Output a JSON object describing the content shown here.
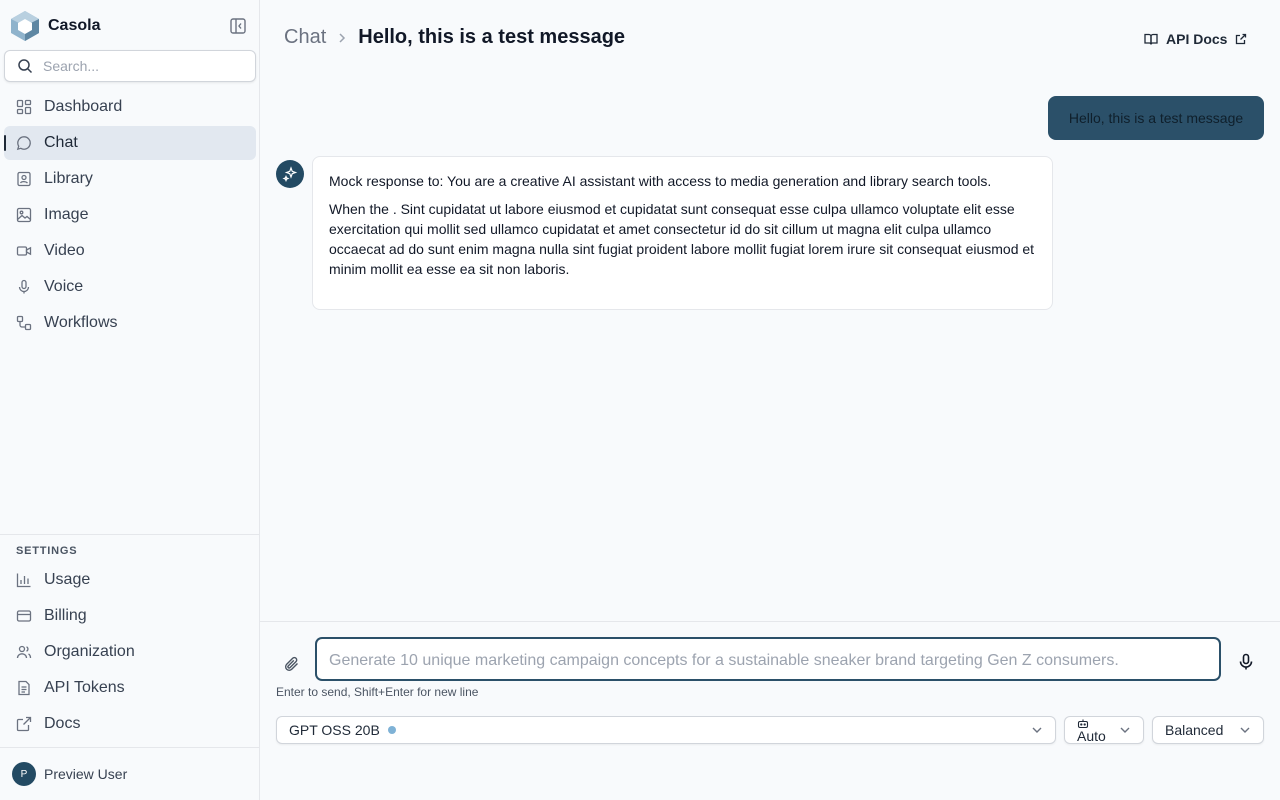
{
  "brand": {
    "name": "Casola"
  },
  "search": {
    "placeholder": "Search..."
  },
  "nav": [
    {
      "label": "Dashboard",
      "icon": "dashboard-icon"
    },
    {
      "label": "Chat",
      "icon": "chat-bubble-icon",
      "active": true
    },
    {
      "label": "Library",
      "icon": "library-icon"
    },
    {
      "label": "Image",
      "icon": "image-icon"
    },
    {
      "label": "Video",
      "icon": "video-icon"
    },
    {
      "label": "Voice",
      "icon": "microphone-icon"
    },
    {
      "label": "Workflows",
      "icon": "workflow-icon"
    }
  ],
  "settings": {
    "label": "SETTINGS",
    "items": [
      {
        "label": "Usage",
        "icon": "bar-chart-icon"
      },
      {
        "label": "Billing",
        "icon": "credit-card-icon"
      },
      {
        "label": "Organization",
        "icon": "users-icon"
      },
      {
        "label": "API Tokens",
        "icon": "document-icon"
      },
      {
        "label": "Docs",
        "icon": "external-link-icon"
      }
    ]
  },
  "user": {
    "initial": "P",
    "name": "Preview User"
  },
  "header": {
    "breadcrumb_root": "Chat",
    "title": "Hello, this is a test message",
    "api_docs": "API Docs"
  },
  "messages": {
    "user": "Hello, this is a test message",
    "assistant": [
      "Mock response to: You are a creative AI assistant with access to media generation and library search tools.",
      "When the . Sint cupidatat ut labore eiusmod et cupidatat sunt consequat esse culpa ullamco voluptate elit esse exercitation qui mollit sed ullamco cupidatat et amet consectetur id do sit cillum ut magna elit culpa ullamco occaecat ad do sunt enim magna nulla sint fugiat proident labore mollit fugiat lorem irure sit consequat eiusmod et minim mollit ea esse ea sit non laboris."
    ]
  },
  "composer": {
    "placeholder": "Generate 10 unique marketing campaign concepts for a sustainable sneaker brand targeting Gen Z consumers.",
    "hint": "Enter to send, Shift+Enter for new line",
    "model": "GPT OSS 20B",
    "mode": "Auto",
    "preset": "Balanced"
  },
  "colors": {
    "accent": "#2b5069",
    "active_nav_bg": "#e2e8f0",
    "status_dot": "#7fb2d6"
  }
}
